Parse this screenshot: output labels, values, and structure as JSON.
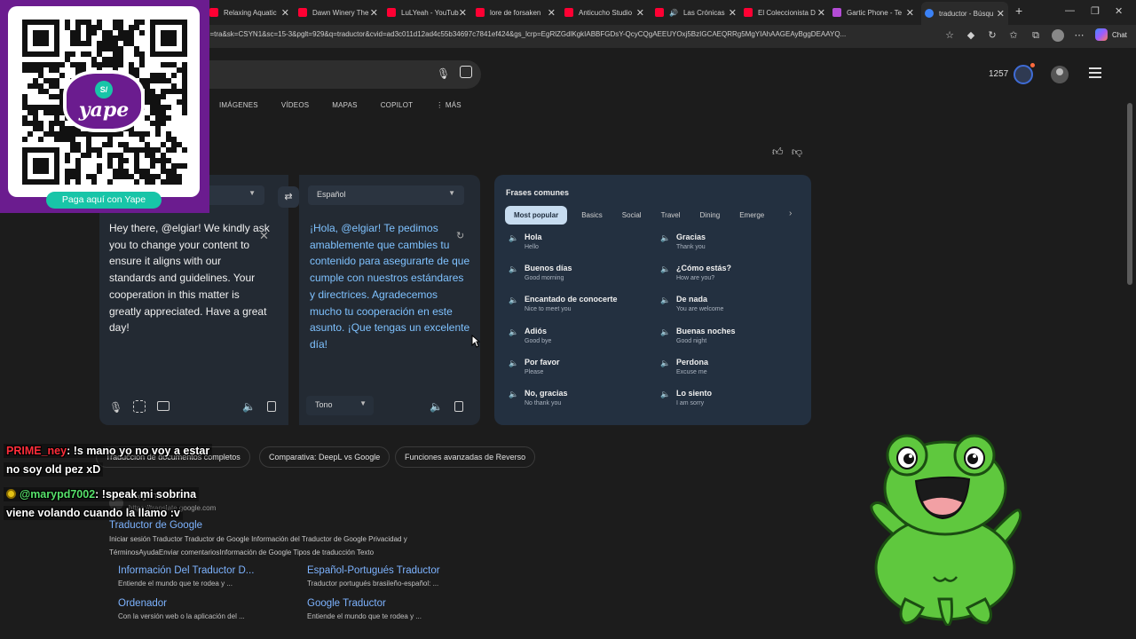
{
  "browser": {
    "tabs": [
      {
        "label": "Relaxing Aquatic",
        "fav_color": "#ff0033"
      },
      {
        "label": "Dawn Winery The",
        "fav_color": "#ff0033"
      },
      {
        "label": "LuLYeah - YouTub",
        "fav_color": "#ff0033"
      },
      {
        "label": "lore de forsaken",
        "fav_color": "#ff0033"
      },
      {
        "label": "Anticucho Studio",
        "fav_color": "#ff0033"
      },
      {
        "label": "Las Crónicas",
        "fav_color": "#ff0033"
      },
      {
        "label": "El Coleccionista D",
        "fav_color": "#ff0033"
      },
      {
        "label": "Gartic Phone - Te",
        "fav_color": "#b44cd6"
      },
      {
        "label": "traductor - Búsqu",
        "fav_color": "#3b82f6"
      }
    ],
    "url": "q=tra&sk=CSYN1&sc=15-3&pglt=929&q=traductor&cvid=ad3c011d12ad4c55b34697c7841ef424&gs_lcrp=EgRlZGdlKgkIABBFGDsY-QcyCQgAEEUYOxj5BzIGCAEQRRg5MgYIAhAAGEAyBggDEAAYQ...",
    "chat_label": "Chat"
  },
  "header": {
    "rewards_points": "1257",
    "scopes": [
      "IMÁGENES",
      "VÍDEOS",
      "MAPAS",
      "COPILOT",
      "⋮ MÁS"
    ]
  },
  "translator": {
    "source_lang": "",
    "target_lang": "Español",
    "source_text": "Hey there, @elgiar! We kindly ask you to change your content to ensure it aligns with our standards and guidelines. Your cooperation in this matter is greatly appreciated. Have a great day!",
    "target_text": "¡Hola, @elgiar! Te pedimos amablemente que cambies tu contenido para asegurarte de que cumple con nuestros estándares y directrices. Agradecemos mucho tu cooperación en este asunto. ¡Que tengas un excelente día!",
    "tone_label": "Tono"
  },
  "phrases": {
    "title": "Frases comunes",
    "tabs": [
      "Most popular",
      "Basics",
      "Social",
      "Travel",
      "Dining",
      "Emerge"
    ],
    "items": [
      {
        "text": "Hola",
        "sub": "Hello"
      },
      {
        "text": "Gracias",
        "sub": "Thank you"
      },
      {
        "text": "Buenos días",
        "sub": "Good morning"
      },
      {
        "text": "¿Cómo estás?",
        "sub": "How are you?"
      },
      {
        "text": "Encantado de conocerte",
        "sub": "Nice to meet you"
      },
      {
        "text": "De nada",
        "sub": "You are welcome"
      },
      {
        "text": "Adiós",
        "sub": "Good bye"
      },
      {
        "text": "Buenas noches",
        "sub": "Good night"
      },
      {
        "text": "Por favor",
        "sub": "Please"
      },
      {
        "text": "Perdona",
        "sub": "Excuse me"
      },
      {
        "text": "No, gracias",
        "sub": "No thank you"
      },
      {
        "text": "Lo siento",
        "sub": "I am sorry"
      }
    ]
  },
  "related": [
    "Traducción de documentos completos",
    "Comparativa: DeepL vs Google",
    "Funciones avanzadas de Reverso"
  ],
  "result": {
    "site": "Google Translate",
    "url": "https://translate.google.com",
    "title": "Traductor de Google",
    "snippet": "Iniciar sesión Traductor Traductor de Google Información del Traductor de Google Privacidad y TérminosAyudaEnviar comentariosInformación de Google Tipos de traducción Texto",
    "sublinks": [
      {
        "title": "Información Del Traductor D...",
        "desc": "Entiende el mundo que te rodea y ..."
      },
      {
        "title": "Español-Portugués Traductor",
        "desc": "Traductor portugués brasileño-español: ..."
      },
      {
        "title": "Ordenador",
        "desc": "Con la versión web o la aplicación del ..."
      },
      {
        "title": "Google Traductor",
        "desc": "Entiende el mundo que te rodea y ..."
      }
    ]
  },
  "overlay": {
    "yape_word": "yape",
    "yape_button": "Paga aquí con Yape",
    "chat": [
      {
        "user": "PRIME_ney",
        "msg": ": !s mano yo no voy a estar",
        "msg2": "no soy old pez xD"
      },
      {
        "user": "@marypd7002",
        "msg": ": !speak mi sobrina",
        "msg2": "viene volando cuando la llamo :v"
      }
    ]
  }
}
